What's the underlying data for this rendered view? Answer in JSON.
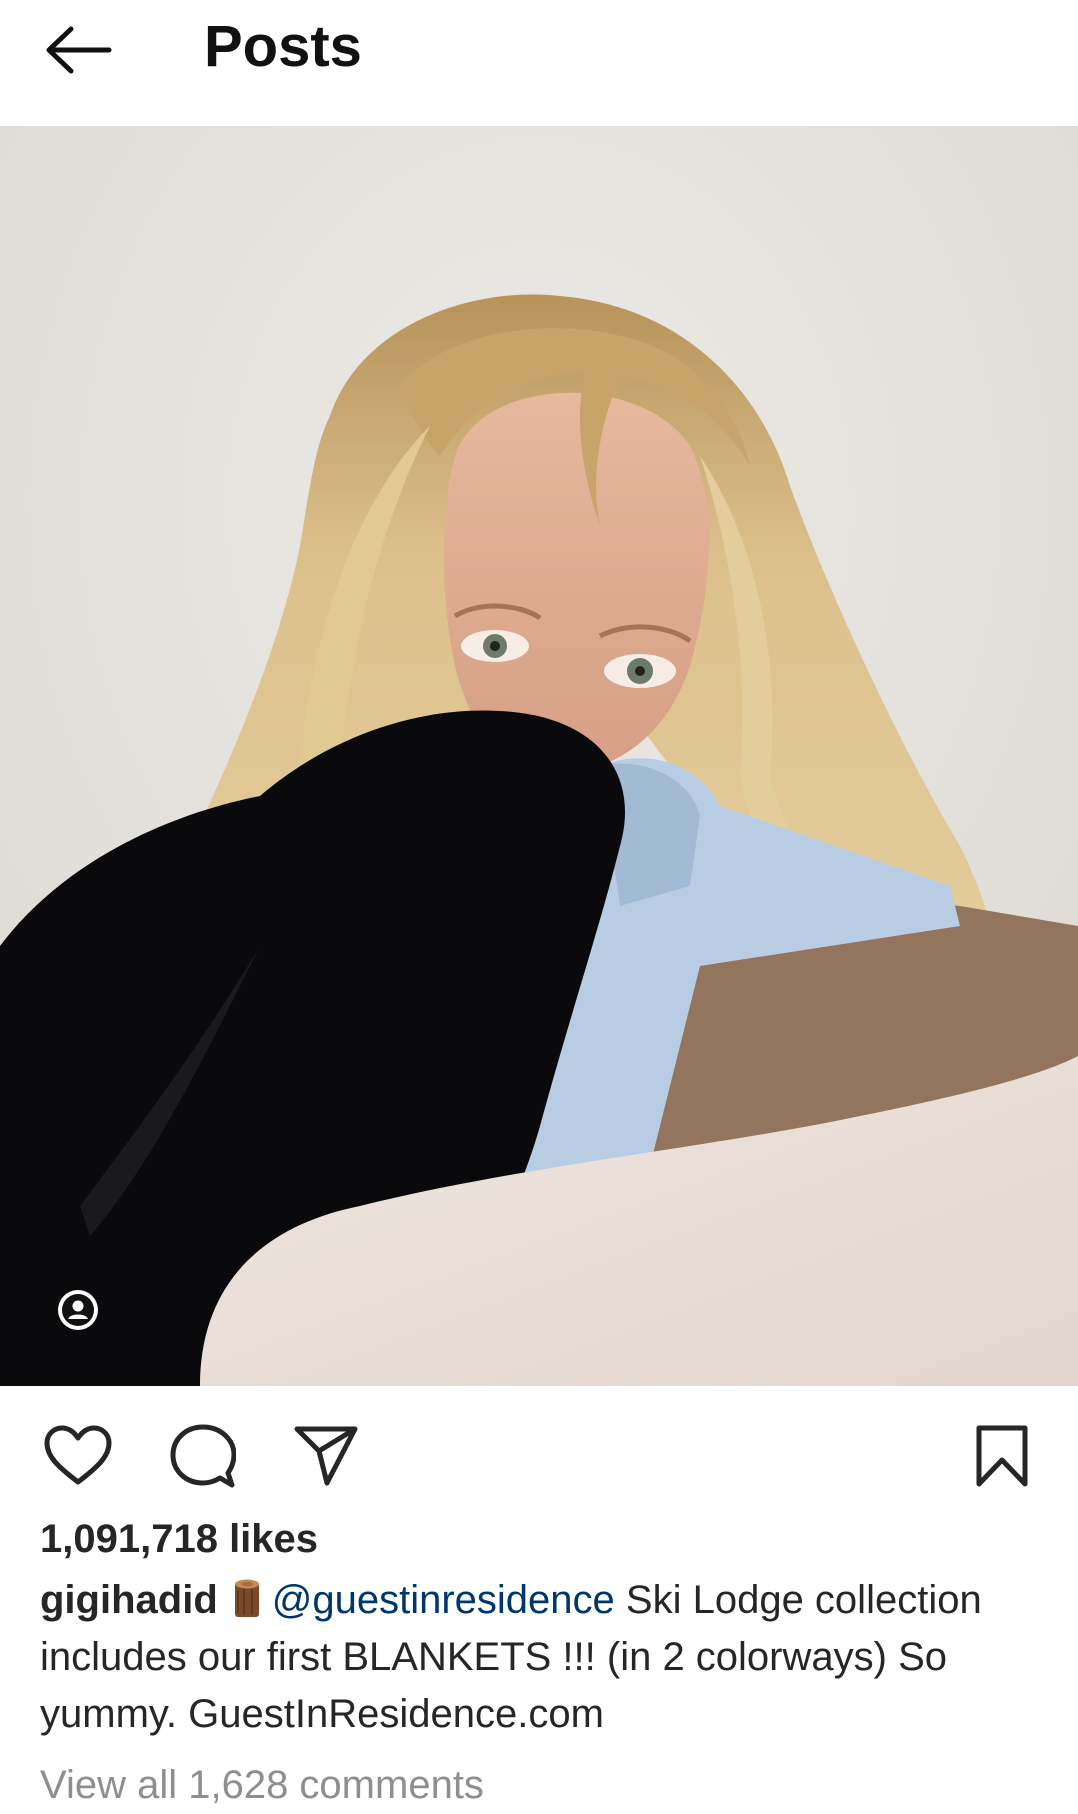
{
  "header": {
    "back_icon": "arrow-left-icon",
    "title": "Posts"
  },
  "post": {
    "image_alt": "Woman with long blonde hair wrapped in a blue and brown striped blanket",
    "tag_icon": "user-tag-icon",
    "actions": {
      "like_icon": "heart-outline-icon",
      "comment_icon": "speech-bubble-icon",
      "share_icon": "paper-plane-icon",
      "save_icon": "bookmark-outline-icon"
    },
    "likes": "1,091,718 likes",
    "caption": {
      "username": "gigihadid",
      "emoji": "🪵",
      "mention": "@guestinresidence",
      "text": " Ski Lodge collection includes our first BLANKETS !!! (in 2 colorways) So yummy. GuestInResidence.com"
    },
    "view_comments": "View all 1,628 comments"
  },
  "colors": {
    "text": "#262626",
    "mention": "#00376b",
    "secondary": "#8e8e8e",
    "background": "#ffffff"
  }
}
